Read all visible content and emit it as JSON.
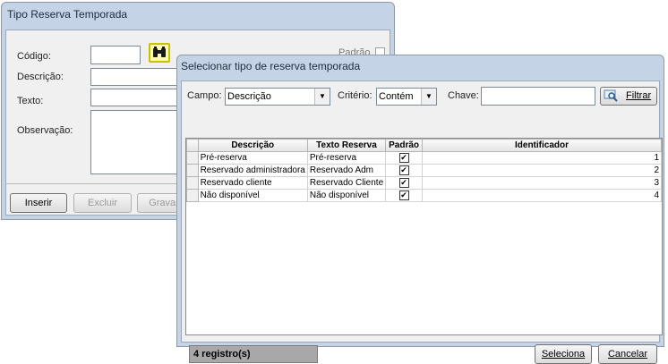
{
  "back_window": {
    "title": "Tipo Reserva Temporada",
    "codigo_label": "Código:",
    "descricao_label": "Descrição:",
    "texto_label": "Texto:",
    "observacao_label": "Observação:",
    "padrao_label": "Padrão",
    "buttons": {
      "inserir": "Inserir",
      "excluir": "Excluir",
      "gravar": "Gravar"
    }
  },
  "dialog": {
    "title": "Selecionar tipo de reserva temporada",
    "campo_label": "Campo:",
    "campo_value": "Descrição",
    "criterio_label": "Critério:",
    "criterio_value": "Contém",
    "chave_label": "Chave:",
    "chave_value": "",
    "filtrar_label": "Filtrar",
    "columns": [
      "Descrição",
      "Texto Reserva",
      "Padrão",
      "Identificador"
    ],
    "rows": [
      {
        "descricao": "Pré-reserva",
        "texto": "Pré-reserva",
        "padrao": true,
        "id": "1"
      },
      {
        "descricao": "Reservado administradora",
        "texto": "Reservado Adm",
        "padrao": true,
        "id": "2"
      },
      {
        "descricao": "Reservado cliente",
        "texto": "Reservado Cliente",
        "padrao": true,
        "id": "3"
      },
      {
        "descricao": "Não disponível",
        "texto": "Não disponível",
        "padrao": true,
        "id": "4"
      }
    ],
    "status": "4 registro(s)",
    "seleciona_label": "Seleciona",
    "cancelar_label": "Cancelar"
  },
  "icons": {
    "search": "binoculars-icon",
    "filter": "filter-search-icon"
  },
  "colors": {
    "frame": "#c4d3e6",
    "highlight": "#fffbb0"
  }
}
